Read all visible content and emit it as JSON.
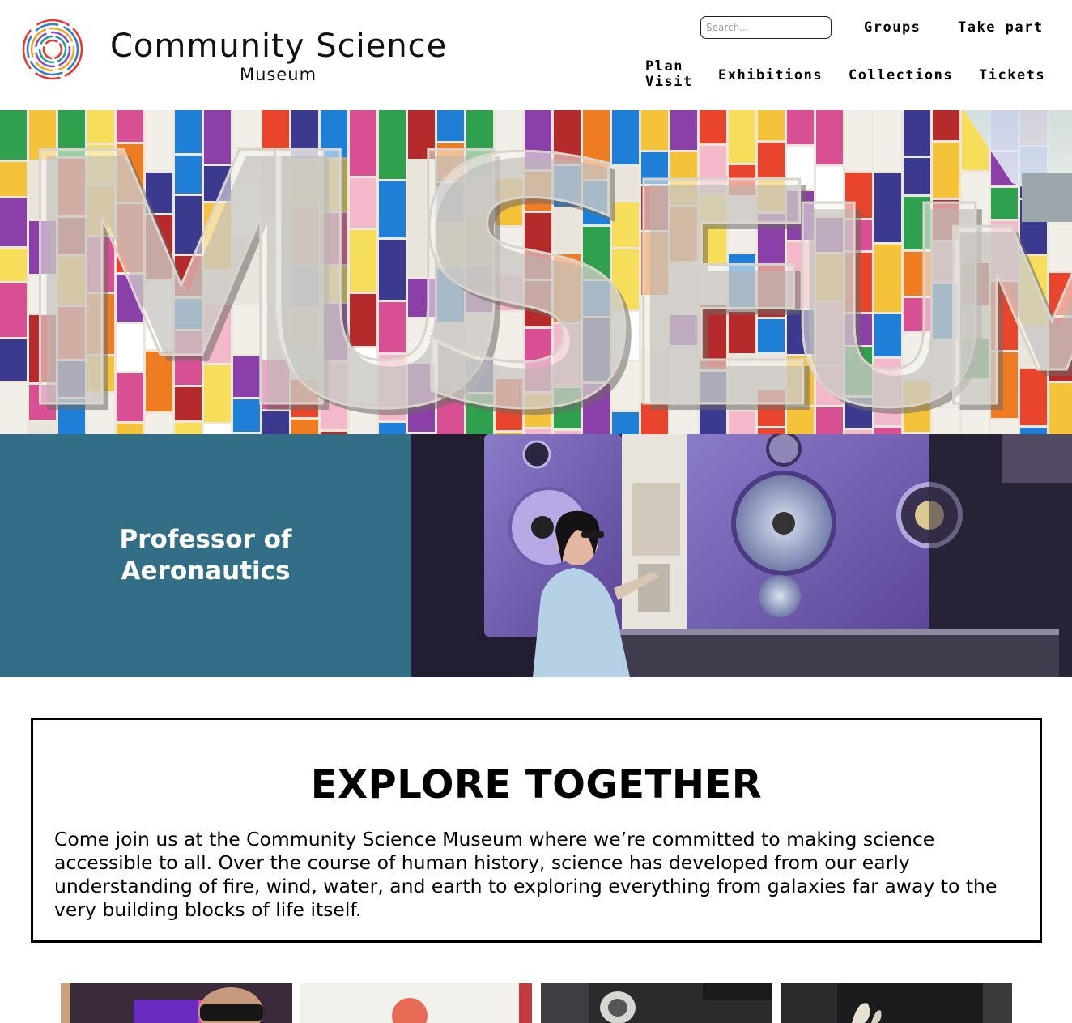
{
  "site": {
    "brand_name": "Community Science",
    "brand_sub": "Museum"
  },
  "search": {
    "placeholder": "Search..."
  },
  "nav": {
    "groups": "Groups",
    "take_part": "Take part",
    "plan_visit": "Plan Visit",
    "exhibitions": "Exhibitions",
    "collections": "Collections",
    "tickets": "Tickets"
  },
  "hero": {
    "sign_letters": "MUSEUM"
  },
  "feature": {
    "title": "Professor of Aeronautics"
  },
  "explore": {
    "title": "EXPLORE TOGETHER",
    "text": "Come join us at the Community Science Museum where we’re committed to making science accessible to all. Over the course of human history, science has developed from our early understanding of fire, wind, water, and earth to exploring everything from galaxies far away to the very building blocks of life itself."
  },
  "colors": {
    "feature_panel": "#336e87",
    "logo_rings": [
      "#e63a2e",
      "#f5a623",
      "#2f7fd1",
      "#8a4fc2",
      "#25a0a8"
    ]
  }
}
